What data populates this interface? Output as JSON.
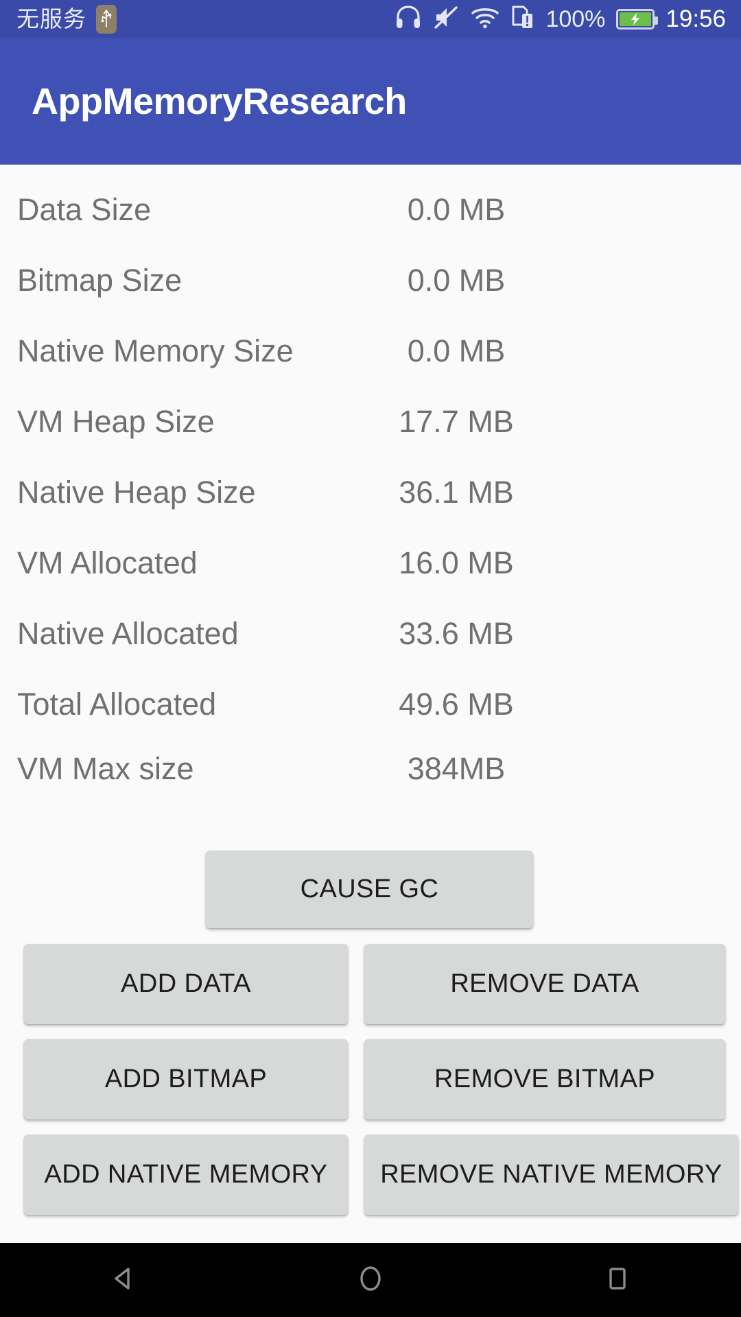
{
  "status_bar": {
    "carrier": "无服务",
    "usb_icon": "usb-icon",
    "icons": [
      "headphones-icon",
      "mute-icon",
      "wifi-icon",
      "dual-sim-alert-icon"
    ],
    "battery_percent": "100%",
    "battery_state": "charging",
    "battery_color": "#6cc04a",
    "clock": "19:56"
  },
  "app_bar": {
    "title": "AppMemoryResearch",
    "background": "#3f51b5"
  },
  "stats": {
    "rows": [
      {
        "label": "Data Size",
        "value": "0.0 MB"
      },
      {
        "label": "Bitmap Size",
        "value": "0.0 MB"
      },
      {
        "label": "Native Memory Size",
        "value": "0.0 MB"
      },
      {
        "label": "VM Heap Size",
        "value": "17.7 MB"
      },
      {
        "label": "Native Heap Size",
        "value": "36.1 MB"
      },
      {
        "label": "VM Allocated",
        "value": "16.0 MB"
      },
      {
        "label": "Native Allocated",
        "value": "33.6 MB"
      },
      {
        "label": "Total Allocated",
        "value": "49.6 MB"
      },
      {
        "label": "VM Max size",
        "value": "384MB"
      }
    ]
  },
  "buttons": {
    "cause_gc": "CAUSE GC",
    "rows": [
      {
        "left": "ADD DATA",
        "right": "REMOVE DATA"
      },
      {
        "left": "ADD BITMAP",
        "right": "REMOVE BITMAP"
      },
      {
        "left": "ADD NATIVE MEMORY",
        "right": "REMOVE NATIVE MEMORY"
      }
    ],
    "background": "#d7d9d9",
    "text_color": "#1d1d1d"
  },
  "nav_bar": {
    "back": "back-triangle-icon",
    "home": "home-circle-icon",
    "recents": "recents-square-icon",
    "background": "#000000"
  }
}
